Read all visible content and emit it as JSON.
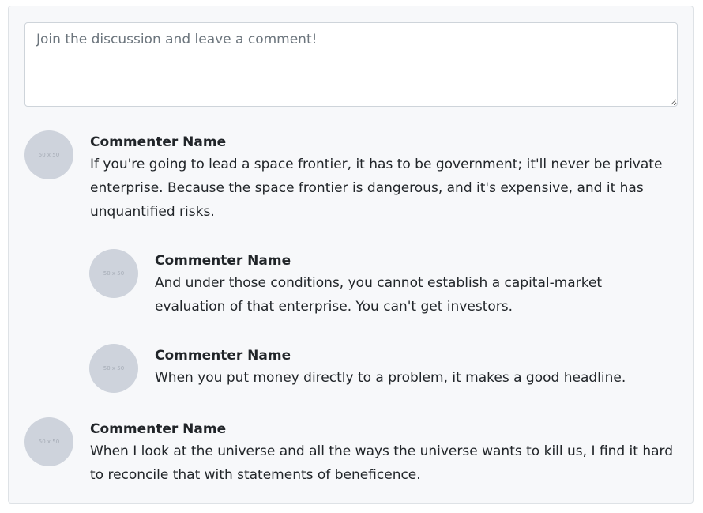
{
  "comment_form": {
    "placeholder": "Join the discussion and leave a comment!"
  },
  "comments": [
    {
      "avatar_text": "50 x 50",
      "name": "Commenter Name",
      "text": "If you're going to lead a space frontier, it has to be government; it'll never be private enterprise. Because the space frontier is dangerous, and it's expensive, and it has unquantified risks.",
      "replies": [
        {
          "avatar_text": "50 x 50",
          "name": "Commenter Name",
          "text": "And under those conditions, you cannot establish a capital-market evaluation of that enterprise. You can't get investors."
        },
        {
          "avatar_text": "50 x 50",
          "name": "Commenter Name",
          "text": "When you put money directly to a problem, it makes a good headline."
        }
      ]
    },
    {
      "avatar_text": "50 x 50",
      "name": "Commenter Name",
      "text": "When I look at the universe and all the ways the universe wants to kill us, I find it hard to reconcile that with statements of beneficence."
    }
  ]
}
